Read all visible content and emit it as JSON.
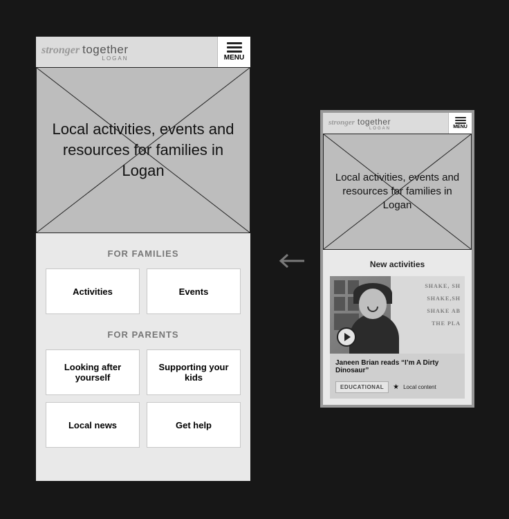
{
  "branding": {
    "word1": "stronger",
    "word2": "together",
    "sub": "LOGAN"
  },
  "menu": {
    "label": "MENU"
  },
  "hero": {
    "headline": "Local activities, events and resources for families in Logan"
  },
  "sectionA": {
    "families_title": "FOR FAMILIES",
    "parents_title": "FOR PARENTS",
    "tiles": {
      "activities": "Activities",
      "events": "Events",
      "looking_after": "Looking after yourself",
      "supporting": "Supporting your kids",
      "local_news": "Local news",
      "get_help": "Get help"
    }
  },
  "sectionB": {
    "title": "New activities",
    "video_title": "Janeen Brian reads “I’m A Dirty Dinosaur”",
    "tag": "EDUCATIONAL",
    "local": "Local content",
    "poster_lines": {
      "l1": "SHAKE, SH",
      "l2": "SHAKE,SH",
      "l3": "SHAKE AB",
      "l4": "THE PLA"
    }
  }
}
